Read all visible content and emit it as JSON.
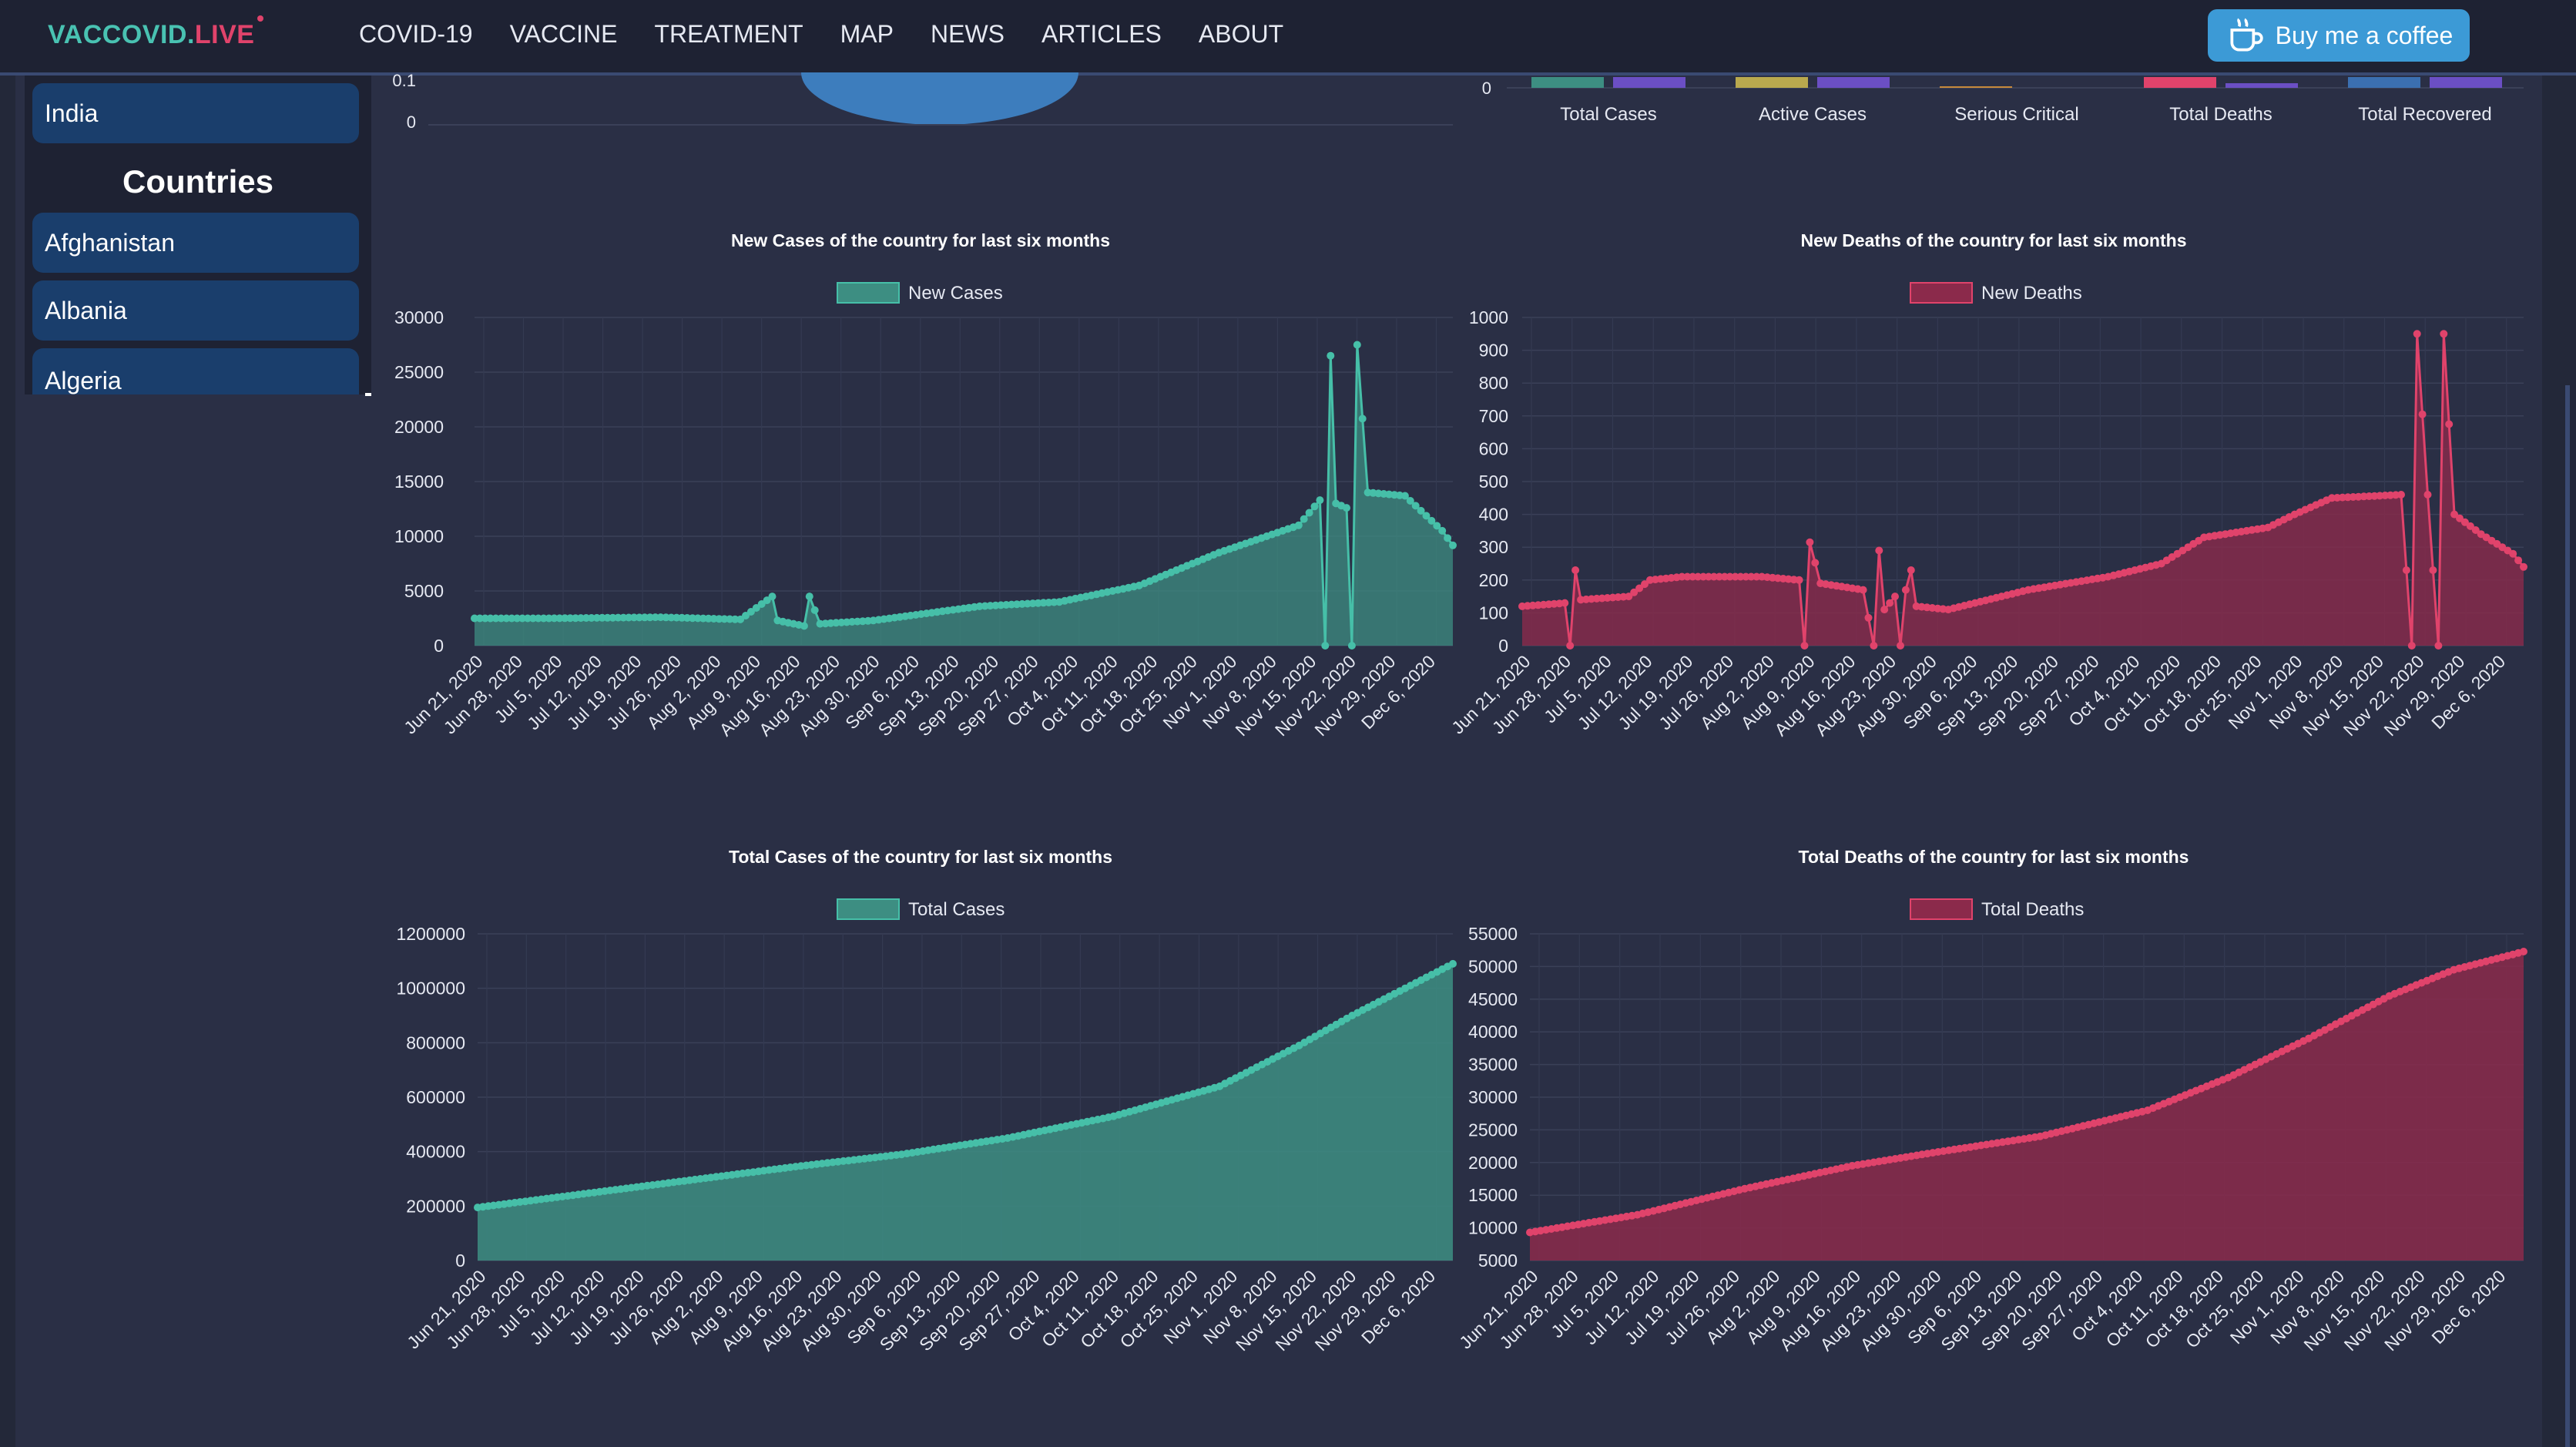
{
  "header": {
    "logo_part1": "VACCOVID.",
    "logo_part2": "LIVE",
    "nav": [
      "COVID-19",
      "VACCINE",
      "TREATMENT",
      "MAP",
      "NEWS",
      "ARTICLES",
      "ABOUT"
    ],
    "coffee_label": "Buy me a coffee",
    "coffee_icon": "coffee-cup-icon"
  },
  "sidebar": {
    "selected_country": "India",
    "heading": "Countries",
    "countries": [
      "Afghanistan",
      "Albania",
      "Algeria"
    ]
  },
  "colors": {
    "cases": "#46bfa8",
    "cases_fill": "#3d8e82",
    "deaths": "#e0436b",
    "deaths_fill": "#8b2a4b",
    "active": "#b9a94e",
    "critical": "#c78a3b",
    "compare": "#6b4fc4",
    "recovered": "#3b6fb0",
    "pie": "#3d7dbd"
  },
  "top_partial": {
    "pie_y_ticks": [
      "0.1",
      "0"
    ],
    "bar_y_tick": "0",
    "bar_categories": [
      "Total Cases",
      "Active Cases",
      "Serious Critical",
      "Total Deaths",
      "Total Recovered"
    ]
  },
  "chart_data": [
    {
      "type": "line",
      "title": "New Cases of the country for last six months",
      "legend": "New Cases",
      "ylim": [
        0,
        30000
      ],
      "y_ticks": [
        "30000",
        "25000",
        "20000",
        "15000",
        "10000",
        "5000",
        "0"
      ],
      "x_ticks": [
        "Jun 21, 2020",
        "Jun 28, 2020",
        "Jul 5, 2020",
        "Jul 12, 2020",
        "Jul 19, 2020",
        "Jul 26, 2020",
        "Aug 2, 2020",
        "Aug 9, 2020",
        "Aug 16, 2020",
        "Aug 23, 2020",
        "Aug 30, 2020",
        "Sep 6, 2020",
        "Sep 13, 2020",
        "Sep 20, 2020",
        "Sep 27, 2020",
        "Oct 4, 2020",
        "Oct 11, 2020",
        "Oct 18, 2020",
        "Oct 25, 2020",
        "Nov 1, 2020",
        "Nov 8, 2020",
        "Nov 15, 2020",
        "Nov 22, 2020",
        "Nov 29, 2020",
        "Dec 6, 2020"
      ],
      "knots": [
        [
          0,
          2500
        ],
        [
          14,
          2500
        ],
        [
          35,
          2600
        ],
        [
          50,
          2400
        ],
        [
          56,
          4500
        ],
        [
          57,
          2300
        ],
        [
          62,
          1800
        ],
        [
          63,
          4500
        ],
        [
          65,
          2000
        ],
        [
          75,
          2300
        ],
        [
          95,
          3600
        ],
        [
          110,
          4000
        ],
        [
          125,
          5500
        ],
        [
          140,
          8500
        ],
        [
          155,
          11000
        ],
        [
          159,
          13300
        ],
        [
          160,
          0
        ],
        [
          161,
          26500
        ],
        [
          162,
          13000
        ],
        [
          164,
          12600
        ],
        [
          165,
          0
        ],
        [
          166,
          27500
        ],
        [
          168,
          14000
        ],
        [
          175,
          13700
        ],
        [
          182,
          10500
        ],
        [
          185,
          8500
        ]
      ]
    },
    {
      "type": "line",
      "title": "New Deaths of the country for last six months",
      "legend": "New Deaths",
      "ylim": [
        0,
        1000
      ],
      "y_ticks": [
        "1000",
        "900",
        "800",
        "700",
        "600",
        "500",
        "400",
        "300",
        "200",
        "100",
        "0"
      ],
      "x_ticks": [
        "Jun 21, 2020",
        "Jun 28, 2020",
        "Jul 5, 2020",
        "Jul 12, 2020",
        "Jul 19, 2020",
        "Jul 26, 2020",
        "Aug 2, 2020",
        "Aug 9, 2020",
        "Aug 16, 2020",
        "Aug 23, 2020",
        "Aug 30, 2020",
        "Sep 6, 2020",
        "Sep 13, 2020",
        "Sep 20, 2020",
        "Sep 27, 2020",
        "Oct 4, 2020",
        "Oct 11, 2020",
        "Oct 18, 2020",
        "Oct 25, 2020",
        "Nov 1, 2020",
        "Nov 8, 2020",
        "Nov 15, 2020",
        "Nov 22, 2020",
        "Nov 29, 2020",
        "Dec 6, 2020"
      ],
      "knots": [
        [
          0,
          120
        ],
        [
          8,
          130
        ],
        [
          9,
          0
        ],
        [
          10,
          230
        ],
        [
          11,
          140
        ],
        [
          20,
          150
        ],
        [
          24,
          200
        ],
        [
          30,
          210
        ],
        [
          45,
          210
        ],
        [
          52,
          200
        ],
        [
          53,
          0
        ],
        [
          54,
          315
        ],
        [
          56,
          190
        ],
        [
          64,
          170
        ],
        [
          66,
          0
        ],
        [
          67,
          290
        ],
        [
          68,
          110
        ],
        [
          70,
          150
        ],
        [
          71,
          0
        ],
        [
          72,
          170
        ],
        [
          73,
          230
        ],
        [
          74,
          120
        ],
        [
          80,
          110
        ],
        [
          95,
          170
        ],
        [
          110,
          210
        ],
        [
          120,
          250
        ],
        [
          128,
          330
        ],
        [
          140,
          360
        ],
        [
          145,
          400
        ],
        [
          152,
          450
        ],
        [
          165,
          460
        ],
        [
          167,
          0
        ],
        [
          168,
          950
        ],
        [
          170,
          460
        ],
        [
          172,
          0
        ],
        [
          173,
          950
        ],
        [
          175,
          400
        ],
        [
          180,
          340
        ],
        [
          186,
          280
        ],
        [
          189,
          220
        ]
      ]
    },
    {
      "type": "area",
      "title": "Total Cases of the country for last six months",
      "legend": "Total Cases",
      "ylim": [
        0,
        1200000
      ],
      "y_ticks": [
        "1200000",
        "1000000",
        "800000",
        "600000",
        "400000",
        "200000",
        "0"
      ],
      "x_ticks": [
        "Jun 21, 2020",
        "Jun 28, 2020",
        "Jul 5, 2020",
        "Jul 12, 2020",
        "Jul 19, 2020",
        "Jul 26, 2020",
        "Aug 2, 2020",
        "Aug 9, 2020",
        "Aug 16, 2020",
        "Aug 23, 2020",
        "Aug 30, 2020",
        "Sep 6, 2020",
        "Sep 13, 2020",
        "Sep 20, 2020",
        "Sep 27, 2020",
        "Oct 4, 2020",
        "Oct 11, 2020",
        "Oct 18, 2020",
        "Oct 25, 2020",
        "Nov 1, 2020",
        "Nov 8, 2020",
        "Nov 15, 2020",
        "Nov 22, 2020",
        "Nov 29, 2020",
        "Dec 6, 2020"
      ],
      "knots": [
        [
          0,
          195000
        ],
        [
          30,
          270000
        ],
        [
          60,
          345000
        ],
        [
          80,
          390000
        ],
        [
          100,
          450000
        ],
        [
          120,
          530000
        ],
        [
          140,
          640000
        ],
        [
          155,
          790000
        ],
        [
          165,
          900000
        ],
        [
          175,
          1000000
        ],
        [
          185,
          1100000
        ]
      ]
    },
    {
      "type": "area",
      "title": "Total Deaths of the country for last six months",
      "legend": "Total Deaths",
      "ylim": [
        5000,
        55000
      ],
      "y_ticks": [
        "55000",
        "50000",
        "45000",
        "40000",
        "35000",
        "30000",
        "25000",
        "20000",
        "15000",
        "10000",
        "5000"
      ],
      "x_ticks": [
        "Jun 21, 2020",
        "Jun 28, 2020",
        "Jul 5, 2020",
        "Jul 12, 2020",
        "Jul 19, 2020",
        "Jul 26, 2020",
        "Aug 2, 2020",
        "Aug 9, 2020",
        "Aug 16, 2020",
        "Aug 23, 2020",
        "Aug 30, 2020",
        "Sep 6, 2020",
        "Sep 13, 2020",
        "Sep 20, 2020",
        "Sep 27, 2020",
        "Oct 4, 2020",
        "Oct 11, 2020",
        "Oct 18, 2020",
        "Oct 25, 2020",
        "Nov 1, 2020",
        "Nov 8, 2020",
        "Nov 15, 2020",
        "Nov 22, 2020",
        "Nov 29, 2020",
        "Dec 6, 2020"
      ],
      "knots": [
        [
          0,
          9300
        ],
        [
          20,
          12000
        ],
        [
          40,
          16000
        ],
        [
          60,
          19500
        ],
        [
          75,
          21500
        ],
        [
          95,
          24000
        ],
        [
          115,
          28000
        ],
        [
          130,
          33000
        ],
        [
          145,
          39000
        ],
        [
          160,
          45500
        ],
        [
          172,
          49500
        ],
        [
          186,
          52500
        ]
      ]
    }
  ]
}
